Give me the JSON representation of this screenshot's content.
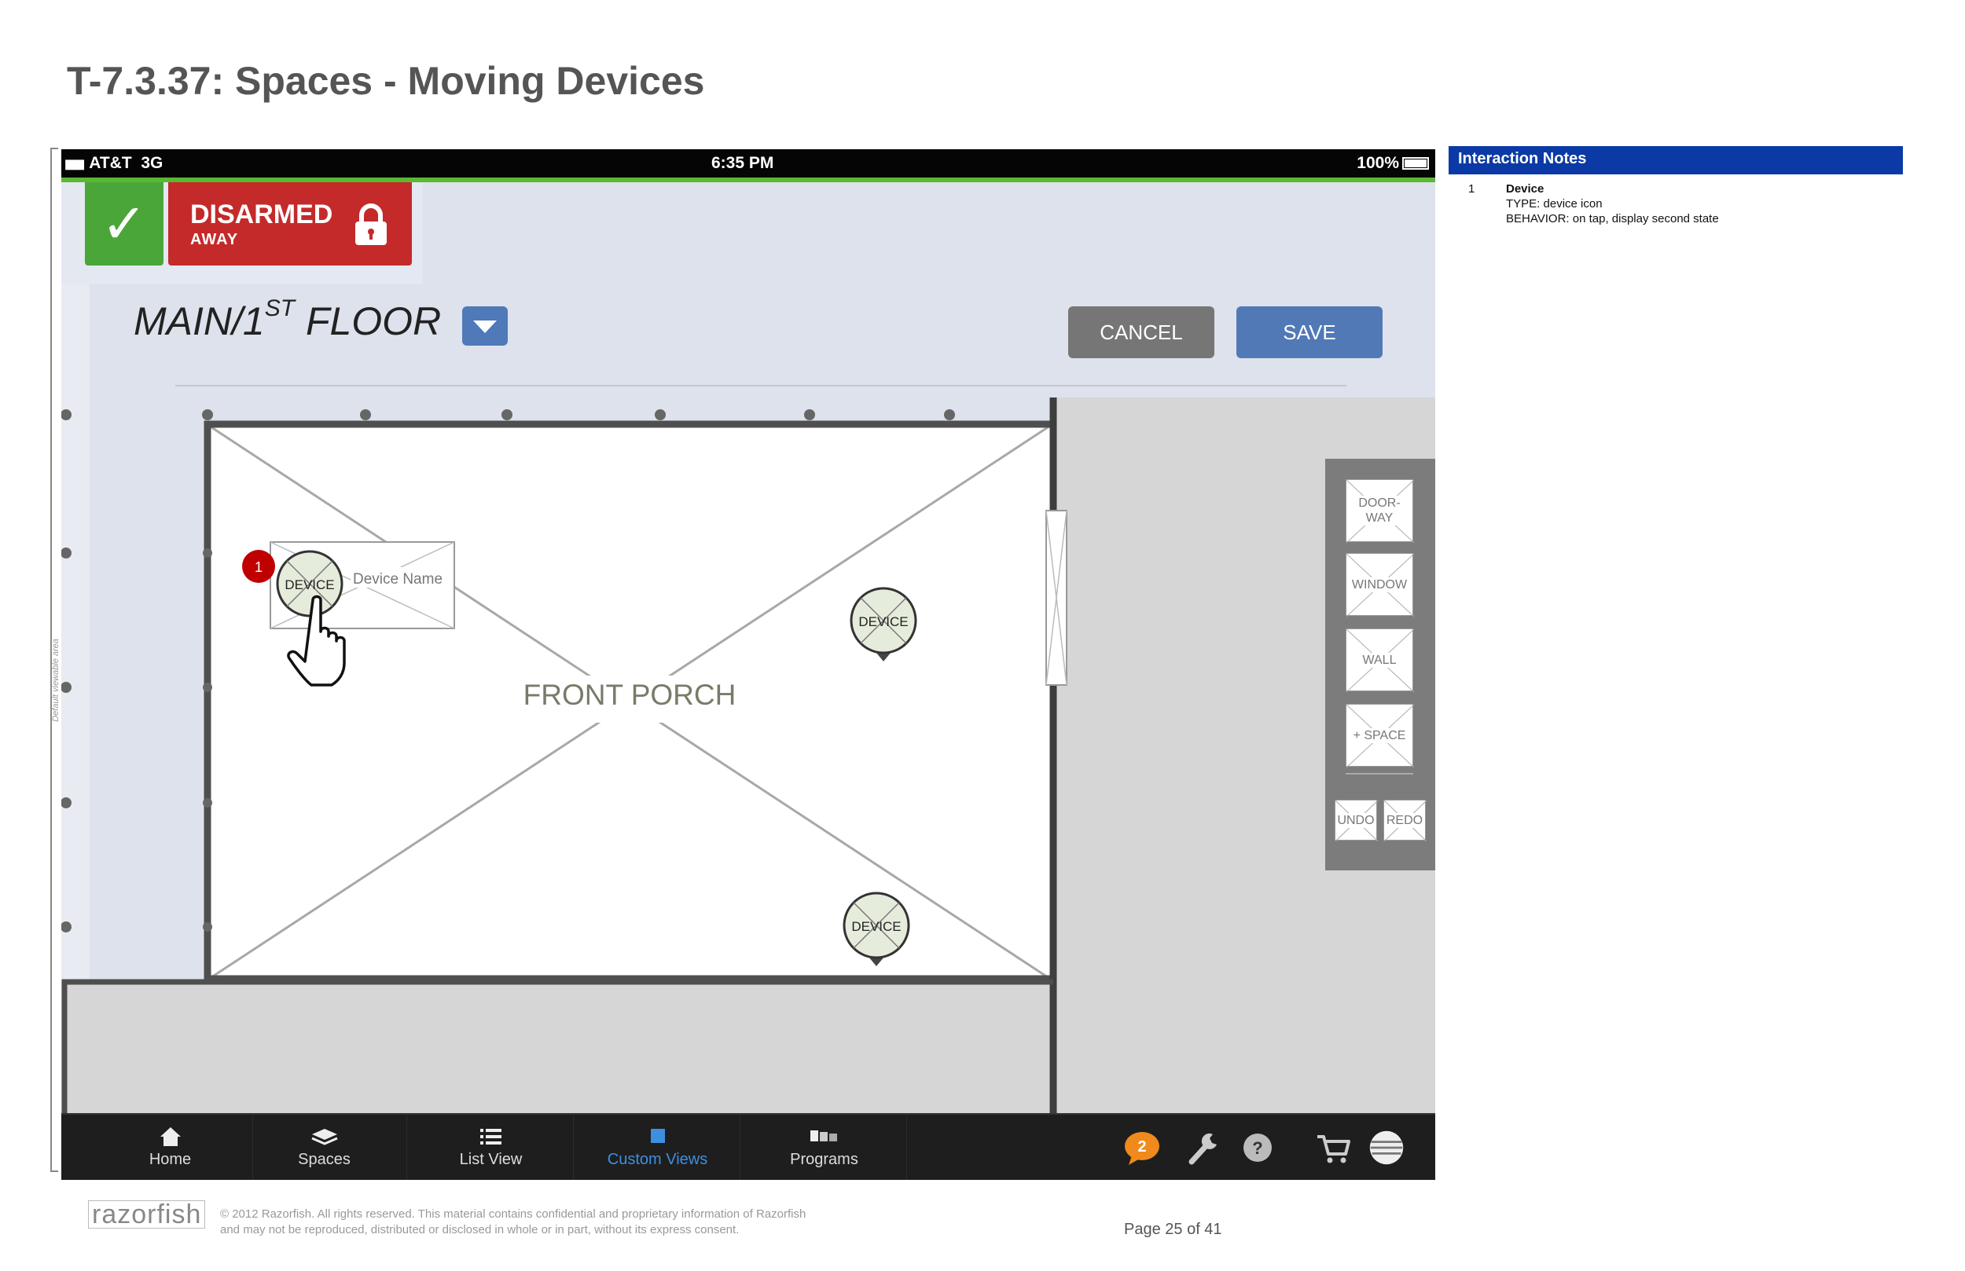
{
  "document": {
    "title": "T-7.3.37: Spaces - Moving Devices",
    "viewable_area_label": "Default viewable area"
  },
  "status_bar": {
    "carrier": "AT&T",
    "network": "3G",
    "time": "6:35 PM",
    "battery": "100%"
  },
  "security": {
    "state": "DISARMED",
    "mode": "AWAY",
    "status_color": "#c42a2a",
    "ok_color": "#4ba63a"
  },
  "header": {
    "floor_prefix": "MAIN/1",
    "floor_sup": "ST",
    "floor_suffix": " FLOOR",
    "cancel_label": "CANCEL",
    "save_label": "SAVE"
  },
  "floorplan": {
    "room_name": "FRONT PORCH",
    "callout_number": "1",
    "selected_device": {
      "label": "DEVICE",
      "name": "Device Name"
    },
    "devices": [
      {
        "label": "DEVICE"
      },
      {
        "label": "DEVICE"
      }
    ]
  },
  "palette": {
    "tools": [
      {
        "line1": "DOOR-",
        "line2": "WAY"
      },
      {
        "line1": "WINDOW",
        "line2": ""
      },
      {
        "line1": "WALL",
        "line2": ""
      },
      {
        "line1": "+ SPACE",
        "line2": ""
      }
    ],
    "undo_label": "UNDO",
    "redo_label": "REDO"
  },
  "tabbar": {
    "tabs": [
      {
        "label": "Home",
        "icon": "home-icon"
      },
      {
        "label": "Spaces",
        "icon": "layers-icon"
      },
      {
        "label": "List View",
        "icon": "list-icon"
      },
      {
        "label": "Custom Views",
        "icon": "custom-views-icon",
        "active": true
      },
      {
        "label": "Programs",
        "icon": "programs-icon"
      }
    ],
    "message_count": "2",
    "active_color": "#3e8fe0"
  },
  "notes": {
    "header": "Interaction Notes",
    "items": [
      {
        "number": "1",
        "title": "Device",
        "type": "TYPE: device icon",
        "behavior": "BEHAVIOR: on tap, display second state"
      }
    ]
  },
  "footer": {
    "logo": "razorfish",
    "copyright_line1": "© 2012 Razorfish. All rights reserved. This material contains confidential and proprietary information of Razorfish",
    "copyright_line2": "and may not be reproduced, distributed or disclosed in whole or in part, without its express consent.",
    "page": "Page  25 of 41"
  }
}
